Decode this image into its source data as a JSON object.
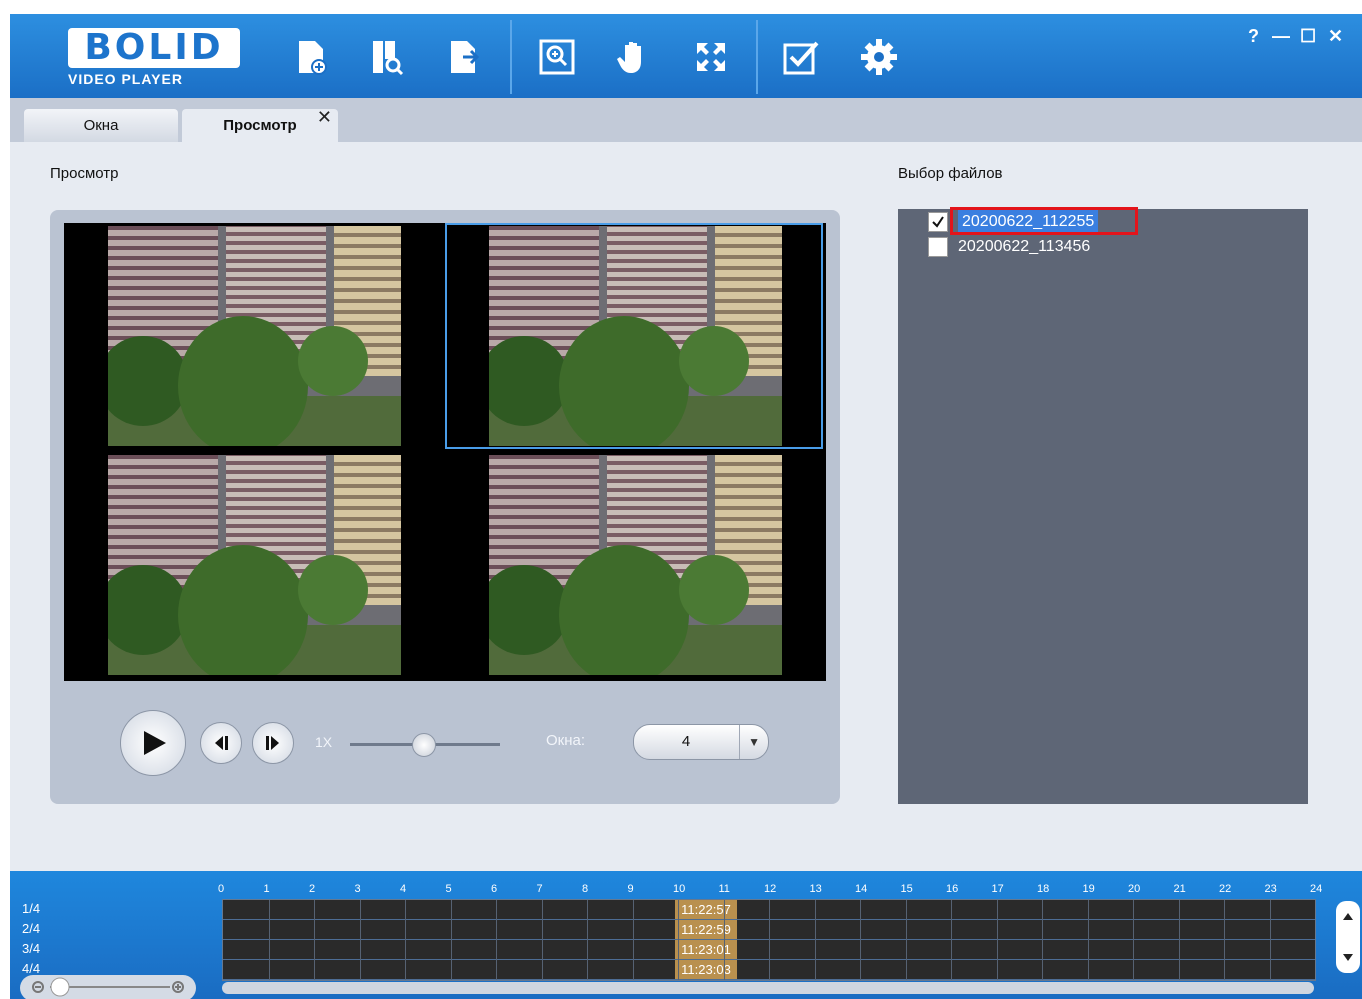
{
  "app": {
    "logo_main": "BOLID",
    "logo_sub": "VIDEO PLAYER"
  },
  "toolbar": {
    "icons": [
      "open-file-icon",
      "search-file-icon",
      "export-icon",
      "zoom-icon",
      "hand-icon",
      "fullscreen-icon",
      "checkbox-icon",
      "settings-icon"
    ]
  },
  "window_controls": {
    "help": "?",
    "minimize": "—",
    "maximize": "☐",
    "close": "✕"
  },
  "tabs": [
    {
      "label": "Окна",
      "active": false
    },
    {
      "label": "Просмотр",
      "active": true,
      "close": "✕"
    }
  ],
  "preview": {
    "title": "Просмотр",
    "speed_label": "1X",
    "windows_label": "Окна:",
    "windows_value": "4"
  },
  "files": {
    "title": "Выбор файлов",
    "items": [
      {
        "name": "20200622_112255",
        "checked": true
      },
      {
        "name": "20200622_113456",
        "checked": false
      }
    ]
  },
  "timeline": {
    "hours": [
      "0",
      "1",
      "2",
      "3",
      "4",
      "5",
      "6",
      "7",
      "8",
      "9",
      "10",
      "11",
      "12",
      "13",
      "14",
      "15",
      "16",
      "17",
      "18",
      "19",
      "20",
      "21",
      "22",
      "23",
      "24"
    ],
    "rows": [
      {
        "label": "1/4",
        "time": "11:22:57"
      },
      {
        "label": "2/4",
        "time": "11:22:59"
      },
      {
        "label": "3/4",
        "time": "11:23:01"
      },
      {
        "label": "4/4",
        "time": "11:23:03"
      }
    ]
  }
}
